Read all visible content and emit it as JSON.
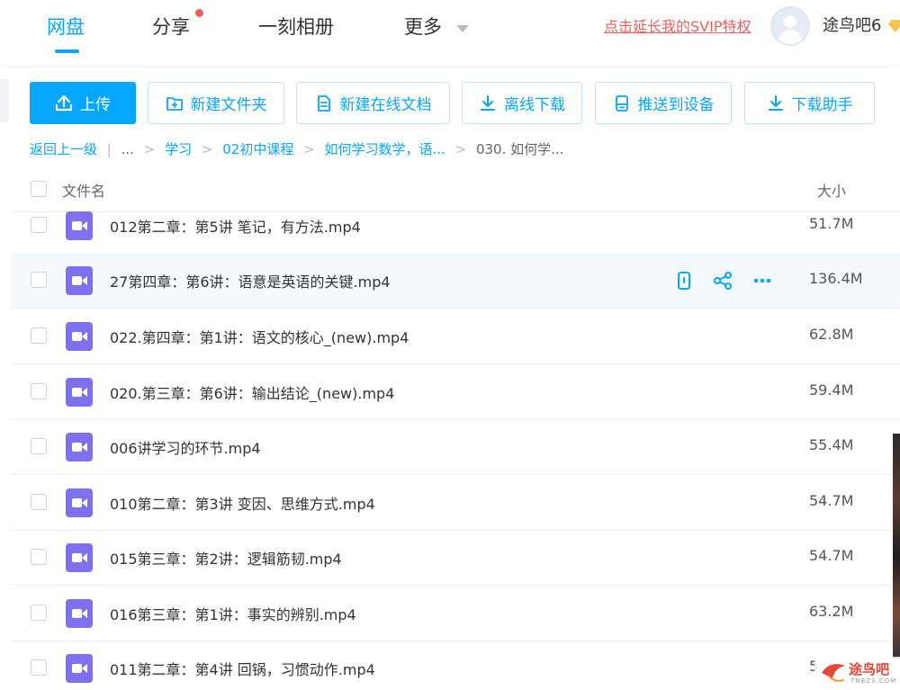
{
  "nav": {
    "items": [
      "网盘",
      "分享",
      "一刻相册",
      "更多"
    ],
    "svip_link": "点击延长我的SVIP特权",
    "username": "途鸟吧6"
  },
  "toolbar": {
    "upload": "上传",
    "new_folder": "新建文件夹",
    "new_doc": "新建在线文档",
    "offline_download": "离线下载",
    "push_device": "推送到设备",
    "download_helper": "下载助手"
  },
  "breadcrumb": {
    "back": "返回上一级",
    "sep": "|",
    "ellipsis": "...",
    "arrow": ">",
    "items": [
      "学习",
      "02初中课程",
      "如何学习数学，语..."
    ],
    "current": "030. 如何学..."
  },
  "list": {
    "header_name": "文件名",
    "header_size": "大小",
    "files": [
      {
        "name": "012第二章：第5讲 笔记，有方法.mp4",
        "size": "51.7M"
      },
      {
        "name": "27第四章：第6讲：语意是英语的关键.mp4",
        "size": "136.4M"
      },
      {
        "name": "022.第四章：第1讲：语文的核心_(new).mp4",
        "size": "62.8M"
      },
      {
        "name": "020.第三章：第6讲：输出结论_(new).mp4",
        "size": "59.4M"
      },
      {
        "name": "006讲学习的环节.mp4",
        "size": "55.4M"
      },
      {
        "name": "010第二章：第3讲 变因、思维方式.mp4",
        "size": "54.7M"
      },
      {
        "name": "015第三章：第2讲：逻辑筋韧.mp4",
        "size": "54.7M"
      },
      {
        "name": "016第三章：第1讲：事实的辨别.mp4",
        "size": "63.2M"
      },
      {
        "name": "011第二章：第4讲 回锅，习惯动作.mp4",
        "size": "5"
      }
    ]
  },
  "watermark": {
    "text": "途鸟吧",
    "sub": "TNBZS.COM"
  },
  "colors": {
    "accent": "#06a7ff",
    "alert": "#f25d5d",
    "video_icon": "#7f70f0"
  }
}
